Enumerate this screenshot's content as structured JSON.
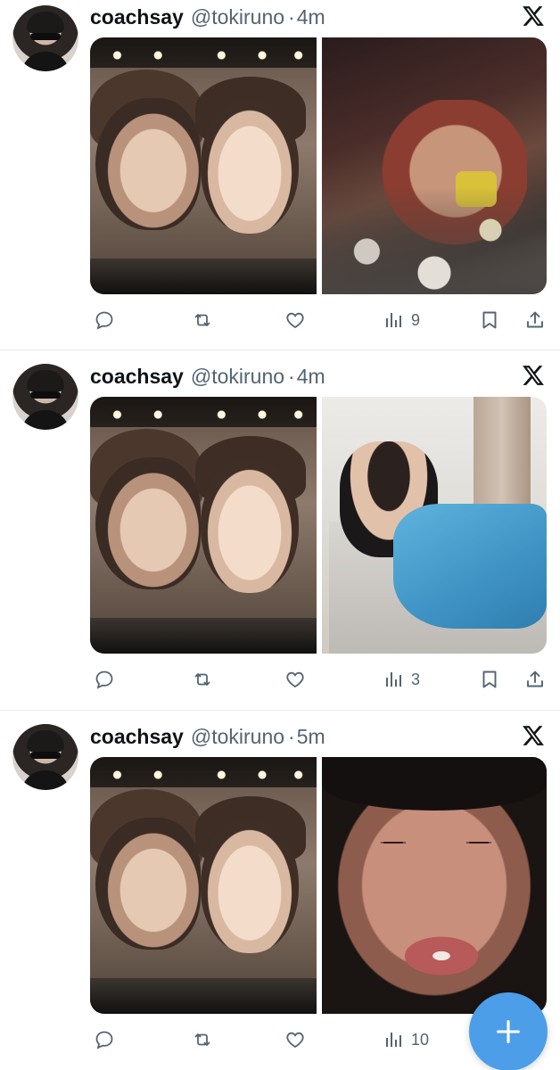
{
  "colors": {
    "text": "#0f1419",
    "secondary": "#536471",
    "fab": "#4c9ee8",
    "divider": "#e6e9ec"
  },
  "tweets": [
    {
      "name": "coachsay",
      "handle": "@tokiruno",
      "separator": "·",
      "time": "4m",
      "views": "9",
      "icons": [
        "reply-icon",
        "retweet-icon",
        "like-icon",
        "views-icon",
        "bookmark-icon",
        "share-icon",
        "x-logo-icon"
      ]
    },
    {
      "name": "coachsay",
      "handle": "@tokiruno",
      "separator": "·",
      "time": "4m",
      "views": "3",
      "icons": [
        "reply-icon",
        "retweet-icon",
        "like-icon",
        "views-icon",
        "bookmark-icon",
        "share-icon",
        "x-logo-icon"
      ]
    },
    {
      "name": "coachsay",
      "handle": "@tokiruno",
      "separator": "·",
      "time": "5m",
      "views": "10",
      "icons": [
        "reply-icon",
        "retweet-icon",
        "like-icon",
        "views-icon",
        "x-logo-icon"
      ]
    }
  ],
  "fab": {
    "icon": "plus-icon"
  }
}
